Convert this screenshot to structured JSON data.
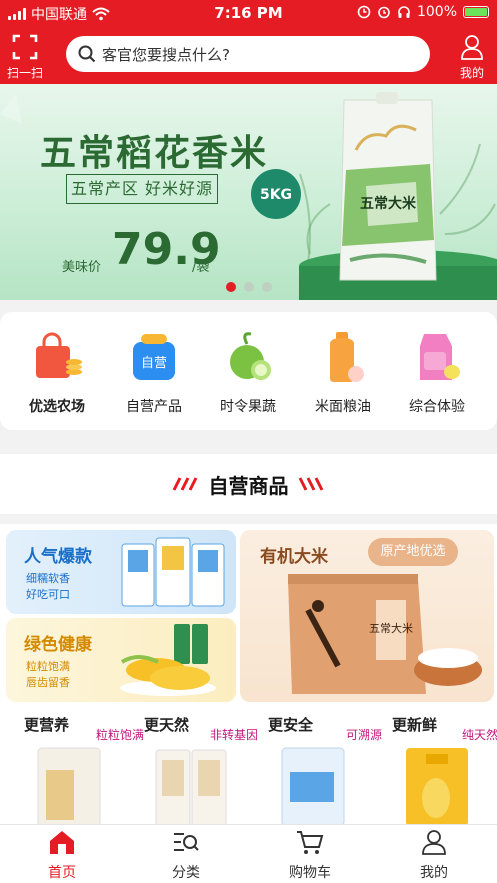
{
  "status_bar": {
    "carrier": "中国联通",
    "time": "7:16 PM",
    "battery": "100%"
  },
  "header": {
    "scan_label": "扫一扫",
    "search_placeholder": "客官您要搜点什么?",
    "mine_label": "我的"
  },
  "banner": {
    "title": "五常稻花香米",
    "subtitle": "五常产区 好米好源",
    "price_label": "美味价",
    "price": "79.9",
    "price_unit": "/袋",
    "badge": "5KG",
    "bag_text": "五常大米",
    "slide_count": 3,
    "active_slide": 1
  },
  "categories": [
    {
      "label": "优选农场",
      "icon": "shopping-bag-icon"
    },
    {
      "label": "自营产品",
      "icon": "self-operated-bag-icon",
      "badge": "自营"
    },
    {
      "label": "时令果蔬",
      "icon": "green-apple-icon"
    },
    {
      "label": "米面粮油",
      "icon": "oil-bottle-icon"
    },
    {
      "label": "综合体验",
      "icon": "milk-carton-icon"
    }
  ],
  "section": {
    "title": "自营商品"
  },
  "promo": {
    "popular": {
      "title": "人气爆款",
      "line1": "细糯软香",
      "line2": "好吃可口"
    },
    "healthy": {
      "title": "绿色健康",
      "line1": "粒粒饱满",
      "line2": "唇齿留香"
    },
    "organic": {
      "title": "有机大米",
      "tag": "原产地优选",
      "box_text": "五常大米"
    },
    "features": [
      {
        "title": "更营养",
        "tag": "粒粒饱满"
      },
      {
        "title": "更天然",
        "tag": "非转基因"
      },
      {
        "title": "更安全",
        "tag": "可溯源"
      },
      {
        "title": "更新鲜",
        "tag": "纯天然"
      }
    ]
  },
  "tabbar": [
    {
      "label": "首页",
      "active": true
    },
    {
      "label": "分类",
      "active": false
    },
    {
      "label": "购物车",
      "active": false
    },
    {
      "label": "我的",
      "active": false
    }
  ],
  "colors": {
    "brand_red": "#e51c23",
    "banner_green": "#2c6a33",
    "popular_blue": "#1a6fc9",
    "healthy_gold": "#d48a00",
    "feature_tag": "#c2187e"
  }
}
